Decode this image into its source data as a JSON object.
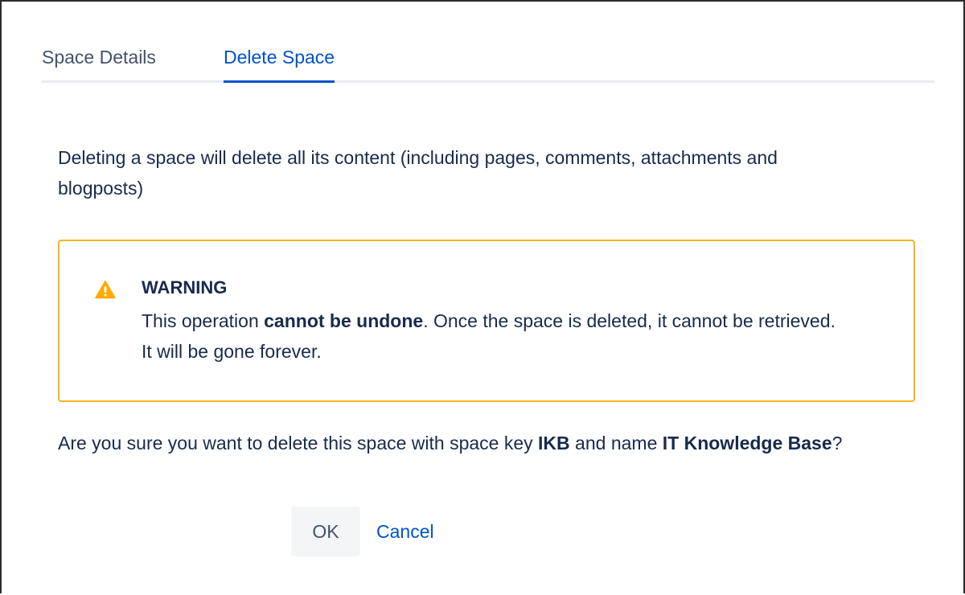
{
  "tabs": [
    {
      "label": "Space Details",
      "active": false
    },
    {
      "label": "Delete Space",
      "active": true
    }
  ],
  "description": "Deleting a space will delete all its content (including pages, comments, attachments and blogposts)",
  "warning": {
    "icon": "warning-icon",
    "title": "WARNING",
    "body_prefix": "This operation ",
    "body_emphasis": "cannot be undone",
    "body_suffix": ". Once the space is deleted, it cannot be retrieved. It will be gone forever."
  },
  "question": {
    "prefix": "Are you sure you want to delete this space with space key ",
    "space_key": "IKB",
    "middle": " and name ",
    "space_name": "IT Knowledge Base",
    "suffix": "?"
  },
  "actions": {
    "ok_label": "OK",
    "cancel_label": "Cancel"
  },
  "colors": {
    "accent": "#0052cc",
    "warning_border": "#f5b41e",
    "warning_icon": "#ffab00",
    "text": "#172b4d"
  }
}
